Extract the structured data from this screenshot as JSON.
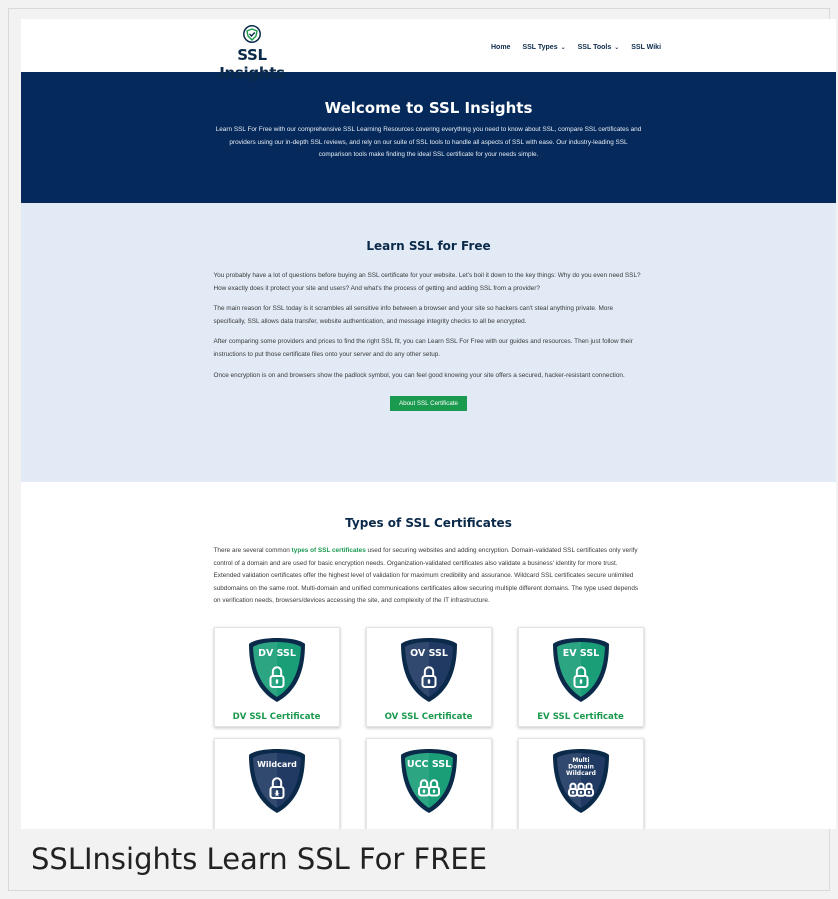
{
  "header": {
    "logo_text": "SSL Insights",
    "nav": [
      {
        "label": "Home",
        "active": true,
        "dropdown": false
      },
      {
        "label": "SSL Types",
        "active": false,
        "dropdown": true
      },
      {
        "label": "SSL Tools",
        "active": false,
        "dropdown": true
      },
      {
        "label": "SSL Wiki",
        "active": false,
        "dropdown": false
      }
    ]
  },
  "hero": {
    "title": "Welcome to SSL Insights",
    "text": "Learn SSL For Free with our comprehensive SSL Learning Resources covering everything you need to know about SSL, compare SSL certificates and providers using our in-depth SSL reviews, and rely on our suite of SSL tools to handle all aspects of SSL with ease. Our industry-leading SSL comparison tools make finding the ideal SSL certificate for your needs simple."
  },
  "learn": {
    "title": "Learn SSL for Free",
    "paragraphs": [
      "You probably have a lot of questions before buying an SSL certificate for your website. Let's boil it down to the key things: Why do you even need SSL? How exactly does it protect your site and users? And what's the process of getting and adding SSL from a provider?",
      "The main reason for SSL today is it scrambles all sensitive info between a browser and your site so hackers can't steal anything private. More specifically, SSL allows data transfer, website authentication, and message integrity checks to all be encrypted.",
      "After comparing some providers and prices to find the right SSL fit, you can Learn SSL For Free with our guides and resources. Then just follow their instructions to put those certificate files onto your server and do any other setup.",
      "Once encryption is on and browsers show the padlock symbol, you can feel good knowing your site offers a secured, hacker-resistant connection."
    ],
    "button_label": "About SSL Certificate"
  },
  "types": {
    "title": "Types of SSL Certificates",
    "intro_before": "There are several common ",
    "intro_link": "types of SSL certificates",
    "intro_after": " used for securing websites and adding encryption. Domain-validated SSL certificates only verify control of a domain and are used for basic encryption needs. Organization-validated certificates also validate a business' identity for more trust. Extended validation certificates offer the highest level of validation for maximum credibility and assurance. Wildcard SSL certificates secure unlimited subdomains on the same root. Multi-domain and unified communications certificates allow securing multiple different domains. The type used depends on verification needs, browsers/devices accessing the site, and complexity of the IT infrastructure.",
    "cards": [
      {
        "badge": "DV SSL",
        "title": "DV SSL Certificate",
        "shield": "#1a9e78",
        "icon": "padlock-icon"
      },
      {
        "badge": "OV SSL",
        "title": "OV SSL Certificate",
        "shield": "#203a63",
        "icon": "padlock-icon"
      },
      {
        "badge": "EV SSL",
        "title": "EV SSL Certificate",
        "shield": "#1a9e78",
        "icon": "padlock-icon"
      },
      {
        "badge": "Wildcard",
        "title": "",
        "shield": "#203a63",
        "icon": "padlock-star-icon"
      },
      {
        "badge": "UCC SSL",
        "title": "",
        "shield": "#1a9e78",
        "icon": "double-padlock-icon"
      },
      {
        "badge": "Multi Domain Wildcard",
        "title": "",
        "shield": "#203a63",
        "icon": "triple-padlock-icon"
      }
    ]
  },
  "caption": "SSLInsights Learn SSL For FREE",
  "colors": {
    "navy": "#04295a",
    "green": "#1a9a4e",
    "light_blue": "#e1eaf5"
  }
}
